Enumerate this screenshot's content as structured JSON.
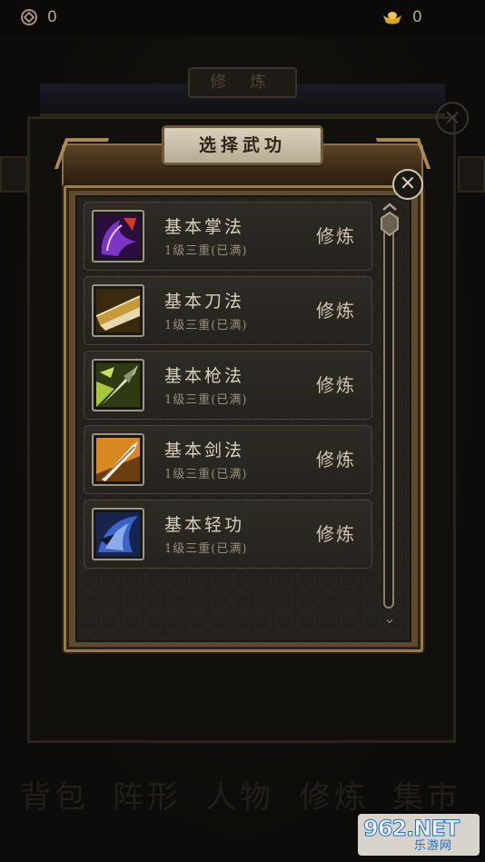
{
  "currency": {
    "coin": {
      "icon": "coin-icon",
      "value": "0"
    },
    "ingot": {
      "icon": "gold-ingot-icon",
      "value": "0"
    }
  },
  "background": {
    "title": "修 炼",
    "tabs": [
      "背包",
      "阵形",
      "人物",
      "修炼",
      "集市"
    ]
  },
  "dialog": {
    "title": "选择武功",
    "close_icon": "close-icon",
    "skills": [
      {
        "name": "基本掌法",
        "level": "1级三重(已满)",
        "action": "修炼",
        "icon": "palm-technique-icon",
        "color": "#6b2fa8"
      },
      {
        "name": "基本刀法",
        "level": "1级三重(已满)",
        "action": "修炼",
        "icon": "blade-technique-icon",
        "color": "#a8741e"
      },
      {
        "name": "基本枪法",
        "level": "1级三重(已满)",
        "action": "修炼",
        "icon": "spear-technique-icon",
        "color": "#7a9a1e"
      },
      {
        "name": "基本剑法",
        "level": "1级三重(已满)",
        "action": "修炼",
        "icon": "sword-technique-icon",
        "color": "#d08a22"
      },
      {
        "name": "基本轻功",
        "level": "1级三重(已满)",
        "action": "修炼",
        "icon": "lightness-skill-icon",
        "color": "#2c4ea0"
      }
    ]
  },
  "watermark": {
    "big": "962.NET",
    "small": "乐游网"
  }
}
